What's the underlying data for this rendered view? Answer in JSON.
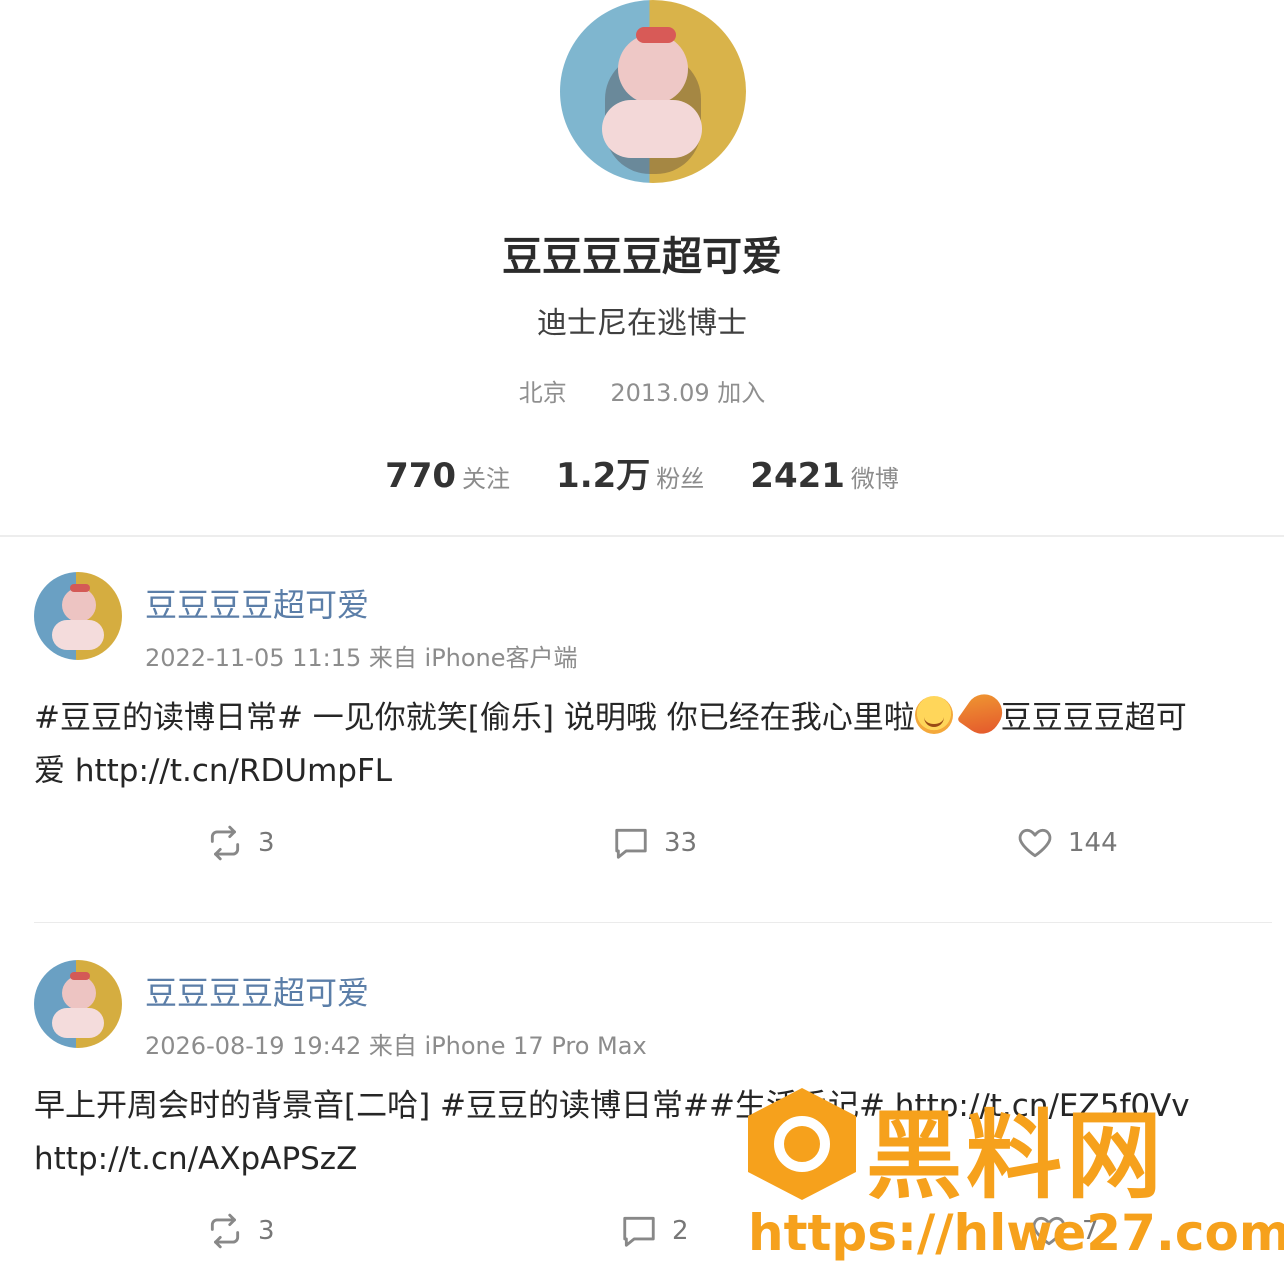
{
  "profile": {
    "name": "豆豆豆豆超可爱",
    "bio": "迪士尼在逃博士",
    "location": "北京",
    "joined": "2013.09 加入",
    "stats": [
      {
        "num": "770",
        "label": "关注"
      },
      {
        "num": "1.2万",
        "label": "粉丝"
      },
      {
        "num": "2421",
        "label": "微博"
      }
    ]
  },
  "posts": [
    {
      "author": "豆豆豆豆超可爱",
      "meta": "2022-11-05 11:15  来自 iPhone客户端",
      "body_line1": "#豆豆的读博日常# 一见你就笑[偷乐] 说明哦 你已经在我心里啦",
      "body_line1_tail": "豆豆豆豆超可",
      "body_line2": "爱 http://t.cn/RDUmpFL",
      "reposts": "3",
      "comments": "33",
      "likes": "144"
    },
    {
      "author": "豆豆豆豆超可爱",
      "meta": "2026-08-19 19:42  来自 iPhone 17 Pro Max",
      "body_line1": "早上开周会时的背景音[二哈] #豆豆的读博日常##生活手记# http://t.cn/EZ5f0Vv",
      "body_line2": "http://t.cn/AXpAPSzZ",
      "reposts": "3",
      "comments": "2",
      "likes": "7"
    }
  ],
  "watermark": {
    "title": "黑料网",
    "url": "https://hlwe27.com",
    "color": "#f6a11c"
  },
  "colors": {
    "link": "#5b7ea8",
    "muted": "#8c8c8c"
  }
}
